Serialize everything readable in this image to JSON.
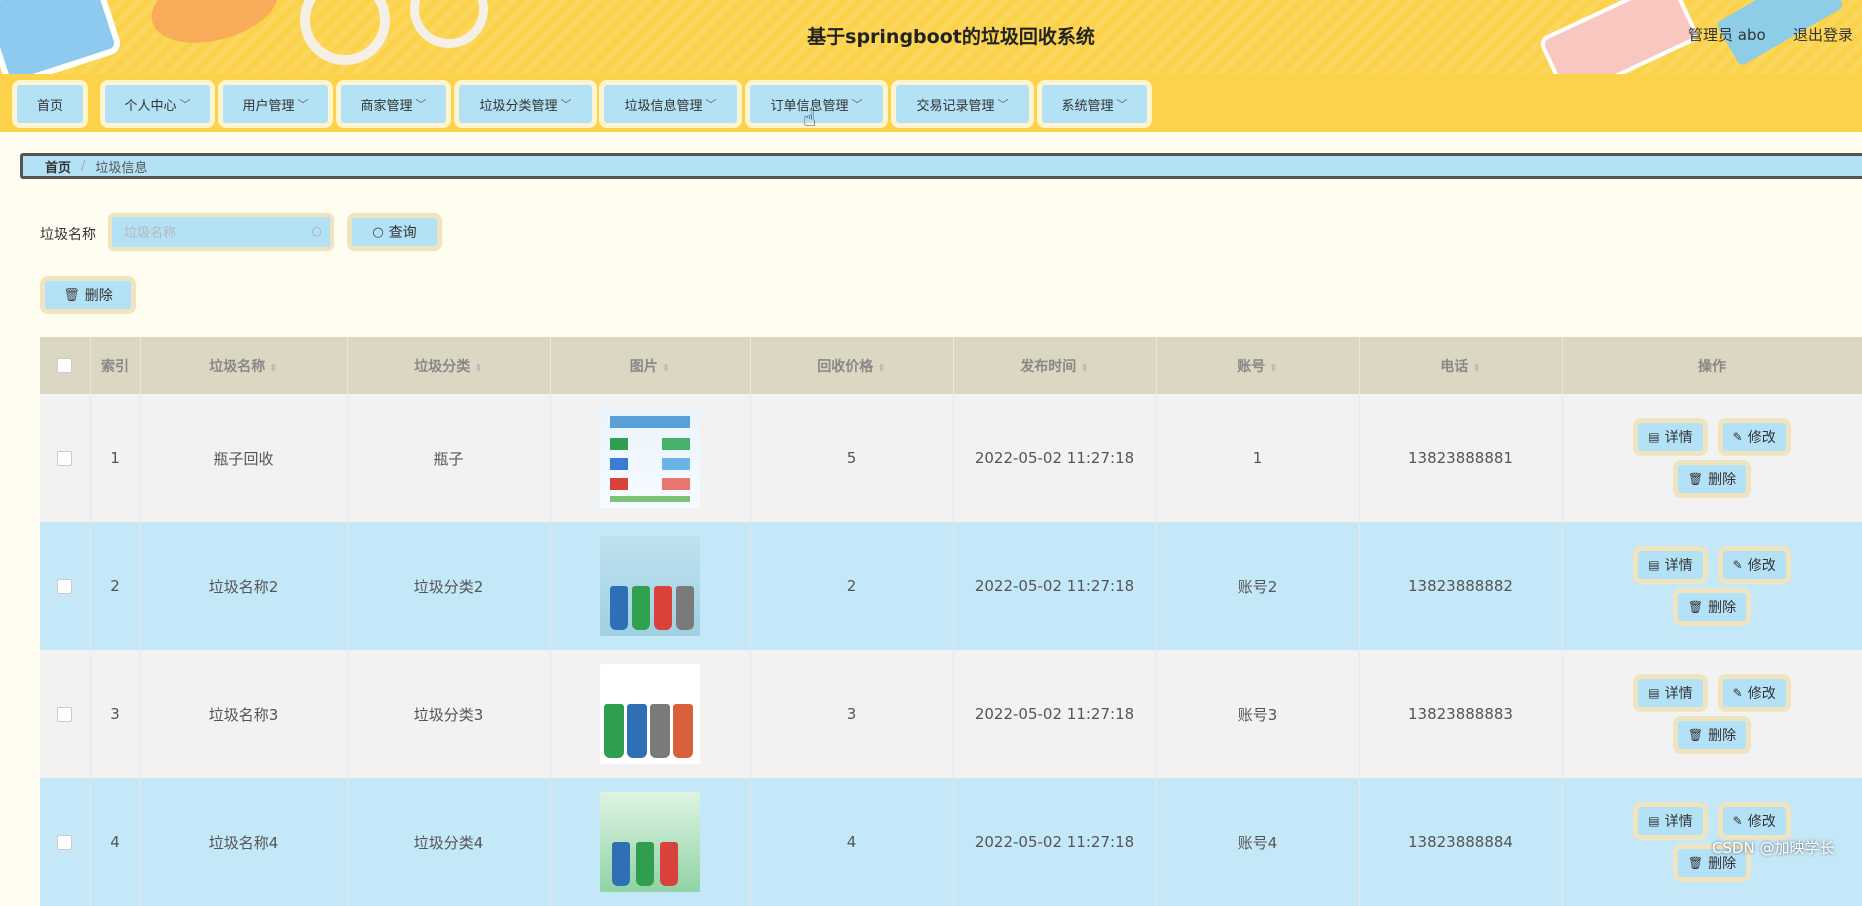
{
  "header": {
    "title": "基于springboot的垃圾回收系统",
    "admin": "管理员 abo",
    "logout": "退出登录"
  },
  "nav": [
    {
      "label": "首页",
      "caret": ""
    },
    {
      "label": "个人中心",
      "caret": "﹀"
    },
    {
      "label": "用户管理",
      "caret": "﹀"
    },
    {
      "label": "商家管理",
      "caret": "﹀"
    },
    {
      "label": "垃圾分类管理",
      "caret": "﹀"
    },
    {
      "label": "垃圾信息管理",
      "caret": "﹀"
    },
    {
      "label": "订单信息管理",
      "caret": "﹀"
    },
    {
      "label": "交易记录管理",
      "caret": "﹀"
    },
    {
      "label": "系统管理",
      "caret": "﹀"
    }
  ],
  "breadcrumb": {
    "home": "首页",
    "separator": "/",
    "current": "垃圾信息"
  },
  "search": {
    "label": "垃圾名称",
    "placeholder": "垃圾名称",
    "value": "",
    "query_button": "查询"
  },
  "toolbar": {
    "delete_button": "删除"
  },
  "table": {
    "headers": [
      "",
      "索引",
      "垃圾名称",
      "垃圾分类",
      "图片",
      "回收价格",
      "发布时间",
      "账号",
      "电话",
      "操作"
    ],
    "rows": [
      {
        "index": "1",
        "name": "瓶子回收",
        "category": "瓶子",
        "price": "5",
        "time": "2022-05-02 11:27:18",
        "account": "1",
        "phone": "13823888881"
      },
      {
        "index": "2",
        "name": "垃圾名称2",
        "category": "垃圾分类2",
        "price": "2",
        "time": "2022-05-02 11:27:18",
        "account": "账号2",
        "phone": "13823888882"
      },
      {
        "index": "3",
        "name": "垃圾名称3",
        "category": "垃圾分类3",
        "price": "3",
        "time": "2022-05-02 11:27:18",
        "account": "账号3",
        "phone": "13823888883"
      },
      {
        "index": "4",
        "name": "垃圾名称4",
        "category": "垃圾分类4",
        "price": "4",
        "time": "2022-05-02 11:27:18",
        "account": "账号4",
        "phone": "13823888884"
      }
    ],
    "actions": {
      "detail": "详情",
      "edit": "修改",
      "delete": "删除"
    }
  },
  "watermark": "CSDN @加映学长",
  "colors": {
    "header_bg": "#fbd24a",
    "button_bg": "#b3e1f5",
    "button_border": "#f0e3c0",
    "page_bg": "#fffcf0"
  }
}
